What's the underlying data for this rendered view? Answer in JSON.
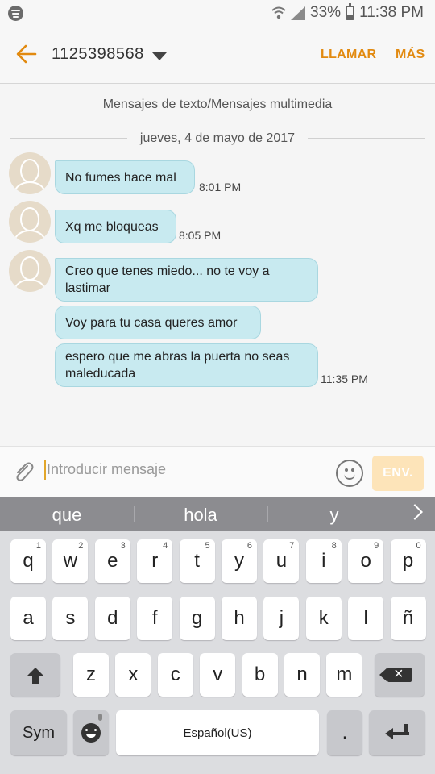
{
  "status_bar": {
    "battery": "33%",
    "time": "11:38 PM"
  },
  "header": {
    "contact": "1125398568",
    "call_label": "LLAMAR",
    "more_label": "MÁS"
  },
  "conversation": {
    "channel_label": "Mensajes de texto/Mensajes multimedia",
    "date_label": "jueves, 4 de mayo de 2017",
    "messages": [
      {
        "text": "No fumes hace mal",
        "time": "8:01 PM"
      },
      {
        "text": "Xq me bloqueas",
        "time": "8:05 PM"
      },
      {
        "text": "Creo que tenes miedo... no te voy a lastimar"
      },
      {
        "text": "Voy para tu casa queres amor"
      },
      {
        "text": "espero que me abras la puerta no seas maleducada",
        "time": "11:35 PM"
      }
    ]
  },
  "composer": {
    "placeholder": "Introducir mensaje",
    "send_label": "ENV."
  },
  "keyboard": {
    "suggestions": [
      "que",
      "hola",
      "y"
    ],
    "row1": [
      {
        "k": "q",
        "n": "1"
      },
      {
        "k": "w",
        "n": "2"
      },
      {
        "k": "e",
        "n": "3"
      },
      {
        "k": "r",
        "n": "4"
      },
      {
        "k": "t",
        "n": "5"
      },
      {
        "k": "y",
        "n": "6"
      },
      {
        "k": "u",
        "n": "7"
      },
      {
        "k": "i",
        "n": "8"
      },
      {
        "k": "o",
        "n": "9"
      },
      {
        "k": "p",
        "n": "0"
      }
    ],
    "row2": [
      "a",
      "s",
      "d",
      "f",
      "g",
      "h",
      "j",
      "k",
      "l",
      "ñ"
    ],
    "row3": [
      "z",
      "x",
      "c",
      "v",
      "b",
      "n",
      "m"
    ],
    "sym_label": "Sym",
    "space_label": "Español(US)",
    "period_label": "."
  },
  "colors": {
    "accent": "#e28a10",
    "bubble": "#c8eaf0",
    "send_disabled": "#fde4b9"
  }
}
